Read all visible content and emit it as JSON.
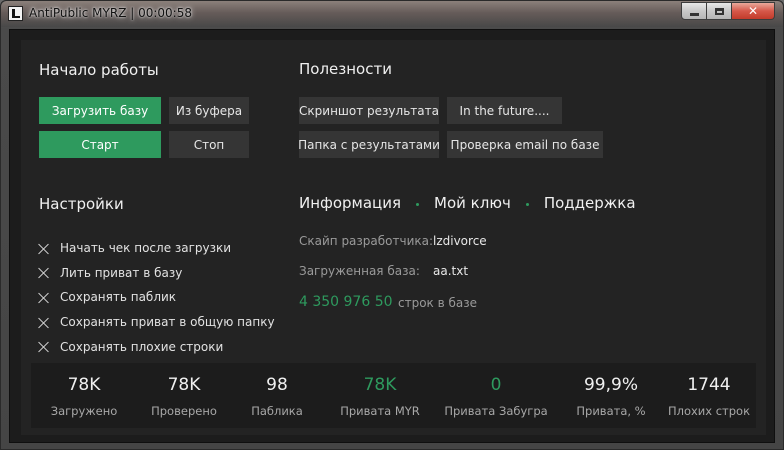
{
  "window": {
    "title": "AntiPublic MYRZ | 00:00:58",
    "close_glyph": "✕"
  },
  "start": {
    "heading": "Начало работы",
    "load_base": "Загрузить базу",
    "from_clipboard": "Из буфера",
    "start": "Старт",
    "stop": "Стоп"
  },
  "utilities": {
    "heading": "Полезности",
    "screenshot": "Скриншот результата",
    "future": "In the future....",
    "results_folder": "Папка с результатами",
    "email_check": "Проверка email по базе"
  },
  "settings": {
    "heading": "Настройки",
    "items": [
      {
        "label": "Начать чек после загрузки",
        "checked": true
      },
      {
        "label": "Лить приват в базу",
        "checked": true
      },
      {
        "label": "Сохранять паблик",
        "checked": true
      },
      {
        "label": "Сохранять приват в общую папку",
        "checked": true
      },
      {
        "label": "Сохранять плохие строки",
        "checked": true
      }
    ]
  },
  "info": {
    "tabs": [
      "Информация",
      "Мой ключ",
      "Поддержка"
    ],
    "dev_skype_label": "Скайп разработчика:",
    "dev_skype_value": "lzdivorce",
    "loaded_base_label": "Загруженная база:",
    "loaded_base_value": "aa.txt",
    "rows_count": "4 350 976 50",
    "rows_label": "строк в базе"
  },
  "stats": [
    {
      "value": "78K",
      "label": "Загружено",
      "green": false
    },
    {
      "value": "78K",
      "label": "Проверено",
      "green": false
    },
    {
      "value": "98",
      "label": "Паблика",
      "green": false
    },
    {
      "value": "78K",
      "label": "Привата MYR",
      "green": true
    },
    {
      "value": "0",
      "label": "Привата Забугра",
      "green": true
    },
    {
      "value": "99,9%",
      "label": "Привата, %",
      "green": false
    },
    {
      "value": "1744",
      "label": "Плохих строк",
      "green": false
    }
  ],
  "colors": {
    "accent": "#2e9a5e",
    "background": "#232323",
    "button": "#353535"
  }
}
